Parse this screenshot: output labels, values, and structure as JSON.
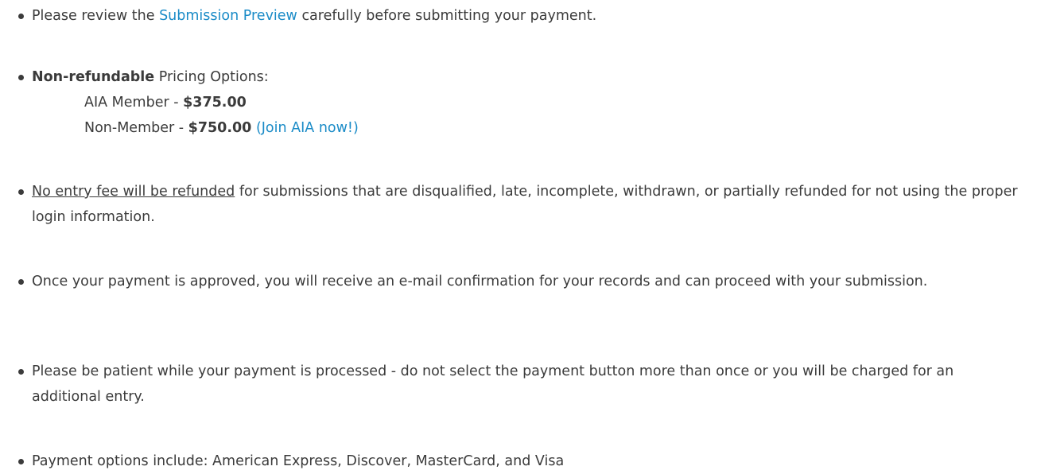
{
  "items": [
    {
      "prefix": "Please review the ",
      "link": "Submission Preview",
      "suffix": " carefully before submitting your payment."
    },
    {
      "bold": "Non-refundable",
      "text": " Pricing Options:",
      "pricing": [
        {
          "label": "AIA Member - ",
          "price": "$375.00"
        },
        {
          "label": "Non-Member - ",
          "price": "$750.00",
          "link": "(Join AIA now!)"
        }
      ]
    },
    {
      "underline": "No entry fee will be refunded",
      "text": " for submissions that are disqualified, late, incomplete, withdrawn, or partially refunded for not using the proper login information."
    },
    {
      "text": "Once your payment is approved, you will receive an e-mail confirmation for your records and can proceed with your submission."
    },
    {
      "text": "Please be patient while your payment is processed - do not select the payment button more than once or you will be charged for an additional entry."
    },
    {
      "text": "Payment options include: American Express, Discover, MasterCard, and Visa"
    }
  ],
  "colors": {
    "text": "#3b3b3b",
    "link": "#1a8bc7",
    "background": "#ffffff"
  }
}
